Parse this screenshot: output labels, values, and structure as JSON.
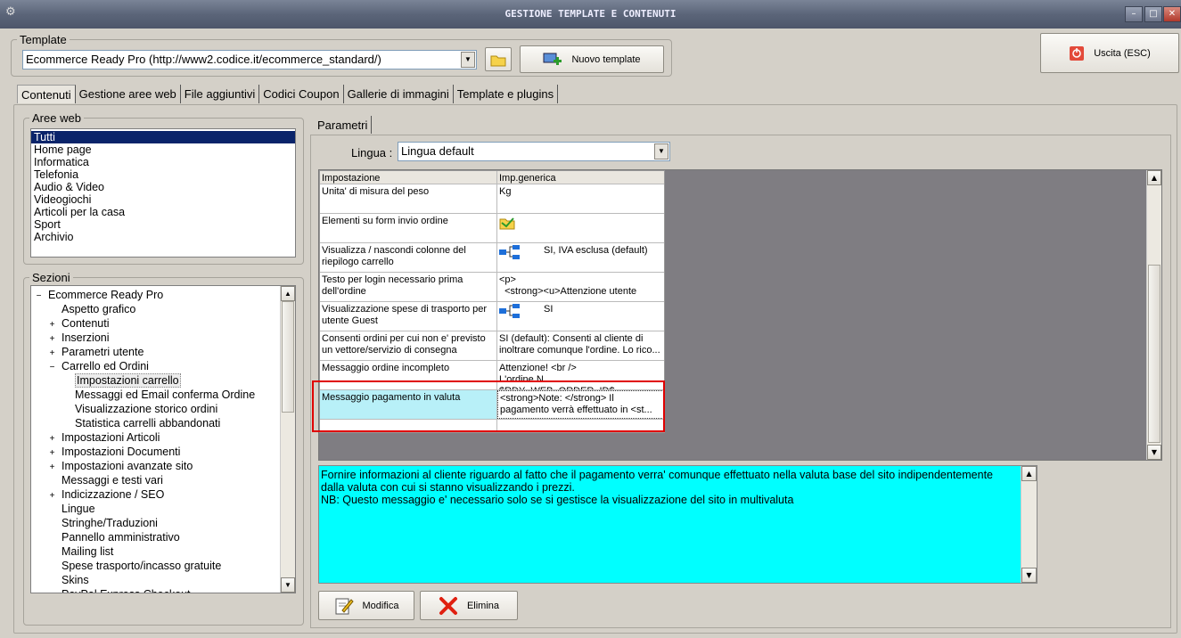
{
  "window": {
    "title": "GESTIONE TEMPLATE E CONTENUTI",
    "min": "–",
    "max": "□",
    "close": "✕"
  },
  "template": {
    "legend": "Template",
    "selected": "Ecommerce Ready Pro (http://www2.codice.it/ecommerce_standard/)",
    "new_button": "Nuovo template"
  },
  "exit_button": "Uscita (ESC)",
  "tabs": [
    "Contenuti",
    "Gestione aree web",
    "File aggiuntivi",
    "Codici Coupon",
    "Gallerie di immagini",
    "Template e plugins"
  ],
  "aree_web": {
    "legend": "Aree web",
    "items": [
      "Tutti",
      "Home page",
      "Informatica",
      "Telefonia",
      "Audio & Video",
      "Videogiochi",
      "Articoli per la casa",
      "Sport",
      "Archivio"
    ]
  },
  "sezioni": {
    "legend": "Sezioni",
    "nodes": [
      {
        "exp": "−",
        "label": "Ecommerce Ready Pro",
        "level": 0
      },
      {
        "exp": "",
        "label": "Aspetto grafico",
        "level": 1
      },
      {
        "exp": "+",
        "label": "Contenuti",
        "level": 1
      },
      {
        "exp": "+",
        "label": "Inserzioni",
        "level": 1
      },
      {
        "exp": "+",
        "label": "Parametri utente",
        "level": 1
      },
      {
        "exp": "−",
        "label": "Carrello ed Ordini",
        "level": 1
      },
      {
        "exp": "",
        "label": "Impostazioni carrello",
        "level": 2,
        "selected": true
      },
      {
        "exp": "",
        "label": "Messaggi ed Email conferma Ordine",
        "level": 2
      },
      {
        "exp": "",
        "label": "Visualizzazione storico ordini",
        "level": 2
      },
      {
        "exp": "",
        "label": "Statistica carrelli abbandonati",
        "level": 2
      },
      {
        "exp": "+",
        "label": "Impostazioni Articoli",
        "level": 1
      },
      {
        "exp": "+",
        "label": "Impostazioni Documenti",
        "level": 1
      },
      {
        "exp": "+",
        "label": "Impostazioni avanzate sito",
        "level": 1
      },
      {
        "exp": "",
        "label": "Messaggi e testi vari",
        "level": 1
      },
      {
        "exp": "+",
        "label": "Indicizzazione / SEO",
        "level": 1
      },
      {
        "exp": "",
        "label": "Lingue",
        "level": 1
      },
      {
        "exp": "",
        "label": "Stringhe/Traduzioni",
        "level": 1
      },
      {
        "exp": "",
        "label": "Pannello amministrativo",
        "level": 1
      },
      {
        "exp": "",
        "label": "Mailing list",
        "level": 1
      },
      {
        "exp": "",
        "label": "Spese trasporto/incasso gratuite",
        "level": 1
      },
      {
        "exp": "",
        "label": "Skins",
        "level": 1
      },
      {
        "exp": "",
        "label": "PayPal Express Checkout",
        "level": 1
      }
    ]
  },
  "parametri": {
    "tab": "Parametri",
    "lingua_label": "Lingua :",
    "lingua_value": "Lingua default",
    "columns": [
      "Impostazione",
      "Imp.generica"
    ],
    "rows": [
      {
        "name": "Unita' di misura del peso",
        "value": "Kg",
        "icon": ""
      },
      {
        "name": "Elementi su form invio ordine",
        "value": "",
        "icon": "folder-icon"
      },
      {
        "name": "Visualizza / nascondi colonne del riepilogo carrello",
        "value": "SI, IVA esclusa (default)",
        "icon": "tree-icon"
      },
      {
        "name": "Testo per login necessario prima dell'ordine",
        "value": "<p>\n  <strong><u>Attenzione utente",
        "icon": ""
      },
      {
        "name": "Visualizzazione spese di trasporto per utente Guest",
        "value": "SI",
        "icon": "tree-icon"
      },
      {
        "name": "Consenti ordini per cui non e' previsto un vettore/servizio di consegna",
        "value": "SI (default): Consenti al cliente di inoltrare comunque l'ordine. Lo rico...",
        "icon": ""
      },
      {
        "name": "Messaggio ordine incompleto",
        "value": "Attenzione! <br />\nL'ordine N. $RDY_WEB_ORDER_ID$",
        "icon": ""
      },
      {
        "name": "Messaggio pagamento in valuta",
        "value": "<strong>Note: </strong> Il pagamento verrà effettuato in <st...",
        "icon": "",
        "selected": true
      }
    ],
    "description": "Fornire informazioni al cliente riguardo al fatto che il pagamento verra' comunque effettuato nella valuta base del sito indipendentemente dalla valuta con cui si stanno visualizzando i prezzi.\nNB: Questo messaggio e' necessario solo se si gestisce la visualizzazione del sito in multivaluta",
    "modify_button": "Modifica",
    "delete_button": "Elimina"
  },
  "colors": {
    "selection": "#0a246a",
    "description_bg": "#00ffff",
    "highlight_box": "#e00000",
    "selected_row": "#b8f0f8"
  }
}
